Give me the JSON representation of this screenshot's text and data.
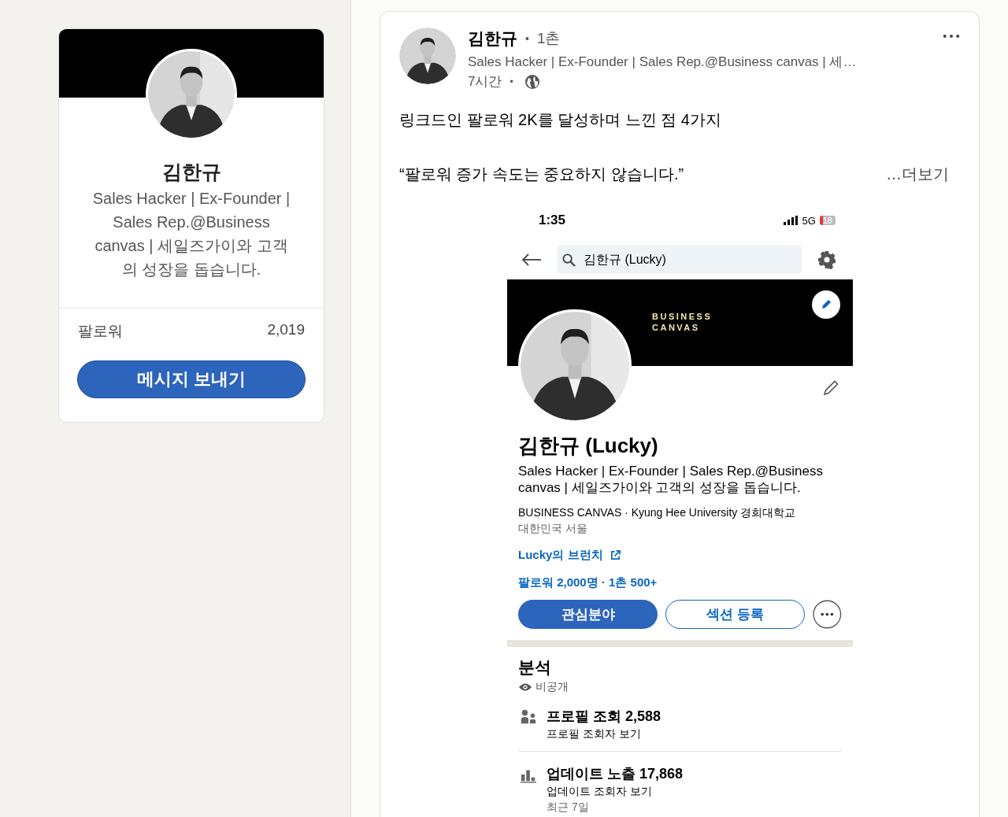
{
  "profile_card": {
    "name": "김한규",
    "headline": "Sales Hacker | Ex-Founder | Sales Rep.@Business canvas | 세일즈가이와 고객의 성장을 돕습니다.",
    "stat_label": "팔로워",
    "stat_value": "2,019",
    "button": "메시지 보내기"
  },
  "post": {
    "author": "김한규",
    "separator": "•",
    "degree": "1촌",
    "headline": "Sales Hacker | Ex-Founder | Sales Rep.@Business canvas | 세…",
    "time": "7시간",
    "time_separator": "•",
    "title": "링크드인 팔로워 2K를 달성하며 느낀 점 4가지",
    "quote": "“팔로워 증가 속도는 중요하지 않습니다.”",
    "more": "…더보기",
    "screenshot": {
      "status_time": "1:35",
      "network": "5G",
      "battery": "18",
      "search": "김한규 (Lucky)",
      "banner_lines": [
        "BUSINESS",
        "CANVAS"
      ],
      "name": "김한규 (Lucky)",
      "headline": "Sales Hacker | Ex-Founder | Sales Rep.@Business canvas | 세일즈가이와 고객의 성장을 돕습니다.",
      "education": "BUSINESS CANVAS · Kyung Hee University 경희대학교",
      "location": "대한민국 서울",
      "link": "Lucky의 브런치",
      "connections": "팔로워 2,000명 · 1촌 500+",
      "buttons": [
        {
          "label": "관심분야",
          "kind": "primary"
        },
        {
          "label": "섹션 등록",
          "kind": "outline"
        }
      ],
      "analytics": {
        "title": "분석",
        "visibility": "비공개",
        "items": [
          {
            "kind": "people",
            "title": "프로필 조회 2,588",
            "subtitle": "프로필 조회자 보기"
          },
          {
            "kind": "chart",
            "title": "업데이트 노출 17,868",
            "subtitle": "업데이트 조회자 보기",
            "note": "최근 7일"
          }
        ]
      }
    }
  }
}
